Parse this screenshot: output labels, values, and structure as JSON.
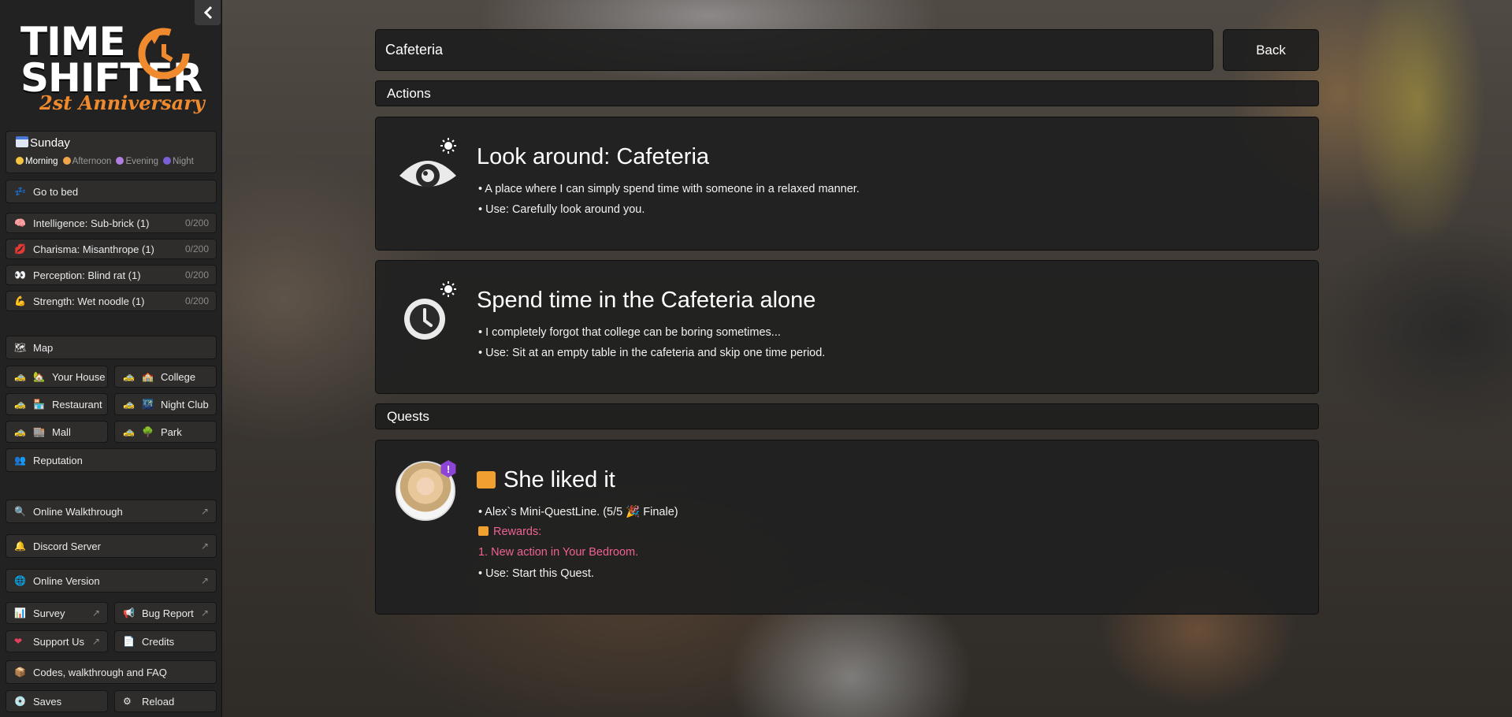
{
  "logo": {
    "line1": "TIME",
    "line2": "SHIFTER",
    "subtitle": "2st Anniversary"
  },
  "calendar": {
    "day": "Sunday",
    "periods": [
      {
        "label": "Morning",
        "color": "#f5c542",
        "active": true
      },
      {
        "label": "Afternoon",
        "color": "#f0a54a",
        "active": false
      },
      {
        "label": "Evening",
        "color": "#b07de0",
        "active": false
      },
      {
        "label": "Night",
        "color": "#7b5fd6",
        "active": false
      }
    ]
  },
  "sidebar": {
    "go_to_bed": "Go to bed",
    "stats": [
      {
        "label": "Intelligence: Sub-brick (1)",
        "value": "0/200",
        "icon": "brain-icon"
      },
      {
        "label": "Charisma: Misanthrope (1)",
        "value": "0/200",
        "icon": "lips-icon"
      },
      {
        "label": "Perception: Blind rat (1)",
        "value": "0/200",
        "icon": "eyes-icon"
      },
      {
        "label": "Strength: Wet noodle (1)",
        "value": "0/200",
        "icon": "flexed-arm-icon"
      }
    ],
    "map": "Map",
    "places": [
      "Your House",
      "College",
      "Restaurant",
      "Night Club",
      "Mall",
      "Park"
    ],
    "reputation": "Reputation",
    "online_walkthrough": "Online Walkthrough",
    "discord": "Discord Server",
    "online_version": "Online Version",
    "survey": "Survey",
    "bug_report": "Bug Report",
    "support": "Support Us",
    "credits": "Credits",
    "codes": "Codes, walkthrough and FAQ",
    "saves": "Saves",
    "reload": "Reload"
  },
  "main": {
    "location": "Cafeteria",
    "back": "Back",
    "actions_header": "Actions",
    "quests_header": "Quests",
    "actions": [
      {
        "title": "Look around: Cafeteria",
        "icon": "eye-icon",
        "lines": [
          "• A place where I can simply spend time with someone in a relaxed manner.",
          "• Use: Carefully look around you."
        ]
      },
      {
        "title": "Spend time in the Cafeteria alone",
        "icon": "clock-icon",
        "lines": [
          "• I completely forgot that college can be boring sometimes...",
          "• Use: Sit at an empty table in the cafeteria and skip one time period."
        ]
      }
    ],
    "quest": {
      "title": "She liked it",
      "line1": "• Alex`s Mini-QuestLine. (5/5 🎉 Finale)",
      "rewards": "Rewards:",
      "reward1": "1. New action in Your Bedroom.",
      "use": "• Use: Start this Quest.",
      "badge": "!"
    }
  }
}
